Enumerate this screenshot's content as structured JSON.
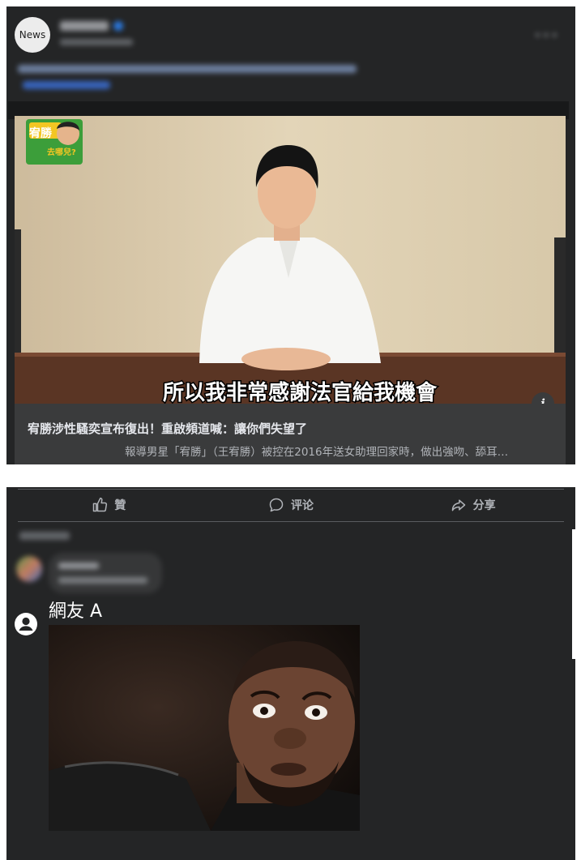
{
  "post": {
    "avatar_text": "News"
  },
  "video": {
    "subtitle": "所以我非常感謝法官給我機會",
    "logo_line1": "宥勝",
    "logo_line2": "去哪兒?"
  },
  "link_preview": {
    "headline": "宥勝涉性騷奕宣布復出！重啟頻道喊：讓你們失望了",
    "description": "報導男星「宥勝」（王宥勝）被控在2016年送女助理回家時，做出強吻、舔耳…"
  },
  "actions": {
    "like": "贊",
    "comment": "评论",
    "share": "分享"
  },
  "reply": {
    "username": "網友 A"
  },
  "colors": {
    "card_bg": "#242526",
    "link_bg": "#3a3b3c",
    "verified": "#2d88ff"
  }
}
